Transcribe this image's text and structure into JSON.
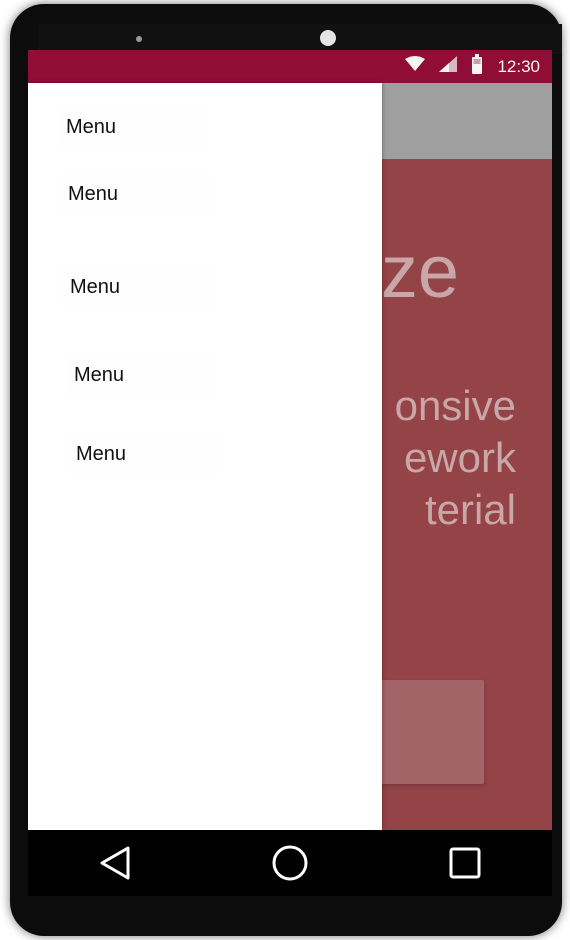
{
  "status_bar": {
    "time": "12:30",
    "icons": [
      "wifi-icon",
      "signal-icon",
      "battery-icon"
    ],
    "color": "#8f0d36"
  },
  "drawer": {
    "menu_items": [
      {
        "label": "Menu"
      },
      {
        "label": "Menu"
      },
      {
        "label": "Menu"
      },
      {
        "label": "Menu"
      },
      {
        "label": "Menu"
      }
    ]
  },
  "hero": {
    "title_fragment": "lize",
    "subtitle_lines": [
      "onsive",
      "ework",
      "terial"
    ],
    "background": "#944347"
  },
  "nav_bar": {
    "buttons": [
      "back-icon",
      "home-icon",
      "recents-icon"
    ]
  }
}
